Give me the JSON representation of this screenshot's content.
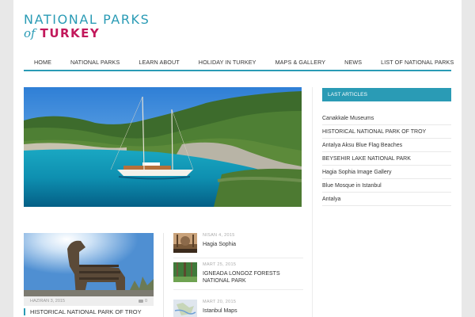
{
  "logo": {
    "line1": "NATIONAL PARKS",
    "of": "of",
    "turkey": "TURKEY"
  },
  "nav": {
    "items": [
      {
        "label": "HOME"
      },
      {
        "label": "NATIONAL PARKS"
      },
      {
        "label": "LEARN ABOUT"
      },
      {
        "label": "HOLIDAY IN TURKEY"
      },
      {
        "label": "MAPS & GALLERY"
      },
      {
        "label": "NEWS"
      },
      {
        "label": "LIST OF NATIONAL PARKS"
      }
    ]
  },
  "featured": {
    "date": "HAZIRAN 3, 2015",
    "comments": "0",
    "title": "HISTORICAL NATIONAL PARK OF TROY"
  },
  "posts": [
    {
      "date": "NISAN 4, 2015",
      "title": "Hagia Sophia",
      "thumb": "mosque-thumb"
    },
    {
      "date": "MART 25, 2015",
      "title": "IGNEADA LONGOZ FORESTS NATIONAL PARK",
      "thumb": "forest-thumb"
    },
    {
      "date": "MART 20, 2015",
      "title": "Istanbul Maps",
      "thumb": "map-thumb"
    }
  ],
  "sidebar": {
    "title": "LAST ARTICLES",
    "items": [
      {
        "label": "Canakkale Museums"
      },
      {
        "label": "HISTORICAL NATIONAL PARK OF TROY"
      },
      {
        "label": "Antalya Aksu Blue Flag Beaches"
      },
      {
        "label": "BEYSEHIR LAKE NATIONAL PARK"
      },
      {
        "label": "Hagia Sophia Image Gallery"
      },
      {
        "label": "Blue Mosque in Istanbul"
      },
      {
        "label": "Antalya"
      }
    ]
  },
  "colors": {
    "accent": "#2a9bb5",
    "brand_red": "#c2185b"
  }
}
